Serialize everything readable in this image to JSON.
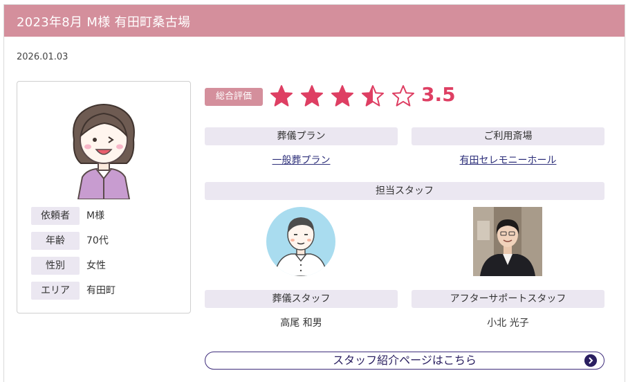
{
  "header": {
    "title": "2023年8月 M様 有田町桑古場"
  },
  "date": "2026.01.03",
  "profile": {
    "rows": [
      {
        "label": "依頼者",
        "value": "M様"
      },
      {
        "label": "年齢",
        "value": "70代"
      },
      {
        "label": "性別",
        "value": "女性"
      },
      {
        "label": "エリア",
        "value": "有田町"
      }
    ]
  },
  "rating": {
    "badge": "総合評価",
    "value": "3.5",
    "score": 3.5,
    "max": 5,
    "color": "#de3f63"
  },
  "plan": {
    "label": "葬儀プラン",
    "value": "一般葬プラン"
  },
  "venue": {
    "label": "ご利用斎場",
    "value": "有田セレモニーホール"
  },
  "staff": {
    "section": "担当スタッフ",
    "funeral": {
      "label": "葬儀スタッフ",
      "name": "高尾 和男"
    },
    "after": {
      "label": "アフターサポートスタッフ",
      "name": "小北 光子"
    }
  },
  "intro_button": {
    "label": "スタッフ紹介ページはこちら"
  }
}
